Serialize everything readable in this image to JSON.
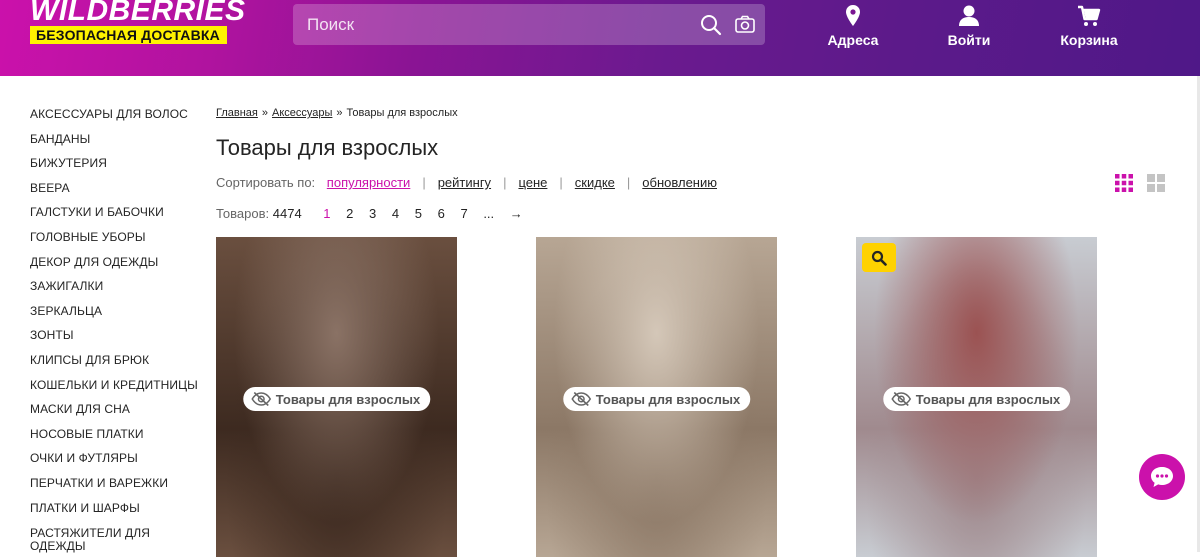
{
  "header": {
    "logo_text": "WILDBERRIES",
    "logo_tagline": "БЕЗОПАСНАЯ ДОСТАВКА",
    "search_placeholder": "Поиск",
    "nav": [
      {
        "label": "Адреса",
        "icon": "location-pin-icon"
      },
      {
        "label": "Войти",
        "icon": "user-icon"
      },
      {
        "label": "Корзина",
        "icon": "cart-icon"
      }
    ]
  },
  "sidebar": {
    "items": [
      "АКСЕССУАРЫ ДЛЯ ВОЛОС",
      "БАНДАНЫ",
      "БИЖУТЕРИЯ",
      "ВЕЕРА",
      "ГАЛСТУКИ И БАБОЧКИ",
      "ГОЛОВНЫЕ УБОРЫ",
      "ДЕКОР ДЛЯ ОДЕЖДЫ",
      "ЗАЖИГАЛКИ",
      "ЗЕРКАЛЬЦА",
      "ЗОНТЫ",
      "КЛИПСЫ ДЛЯ БРЮК",
      "КОШЕЛЬКИ И КРЕДИТНИЦЫ",
      "МАСКИ ДЛЯ СНА",
      "НОСОВЫЕ ПЛАТКИ",
      "ОЧКИ И ФУТЛЯРЫ",
      "ПЕРЧАТКИ И ВАРЕЖКИ",
      "ПЛАТКИ И ШАРФЫ",
      "РАСТЯЖИТЕЛИ ДЛЯ ОДЕЖДЫ"
    ]
  },
  "breadcrumb": {
    "home": "Главная",
    "section": "Аксессуары",
    "current": "Товары для взрослых",
    "separator": "»"
  },
  "page_title": "Товары для взрослых",
  "sort": {
    "label": "Сортировать по:",
    "options": [
      "популярности",
      "рейтингу",
      "цене",
      "скидке",
      "обновлению"
    ],
    "active_index": 0
  },
  "listing": {
    "count_label": "Товаров:",
    "count_value": "4474",
    "pages": [
      "1",
      "2",
      "3",
      "4",
      "5",
      "6",
      "7",
      "...",
      "→"
    ],
    "active_page": "1"
  },
  "cards": [
    {
      "badge": "Товары для взрослых",
      "palette": [
        "#6a4f3f",
        "#3d2a20",
        "#8a7265"
      ],
      "zoom": false
    },
    {
      "badge": "Товары для взрослых",
      "palette": [
        "#b7a694",
        "#8c7866",
        "#d4c7b8"
      ],
      "zoom": false
    },
    {
      "badge": "Товары для взрослых",
      "palette": [
        "#c8ccd2",
        "#a08a8e",
        "#9b5252"
      ],
      "zoom": true
    }
  ],
  "colors": {
    "accent": "#cb11ab",
    "header_start": "#cb11ab",
    "header_end": "#4f1888",
    "logo_tag_bg": "#fff200",
    "zoom_badge": "#ffd200"
  }
}
